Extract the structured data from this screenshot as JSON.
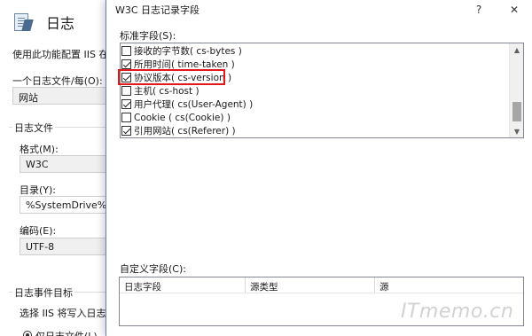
{
  "background_panel": {
    "title": "日志",
    "description": "使用此功能配置 IIS 在 W",
    "one_log_per_label": "一个日志文件/每(O):",
    "one_log_per_value": "网站",
    "log_file_group": "日志文件",
    "format_label": "格式(M):",
    "format_value": "W3C",
    "directory_label": "目录(Y):",
    "directory_value": "%SystemDrive%\\inet",
    "encoding_label": "编码(E):",
    "encoding_value": "UTF-8",
    "event_target_group": "日志事件目标",
    "event_target_desc": "选择 IIS 将写入日志事",
    "radio_label": "仅日志文件(L)"
  },
  "dialog": {
    "title": "W3C 日志记录字段",
    "help_button": "?",
    "close_button": "✕",
    "standard_fields_label": "标准字段(S):",
    "standard_fields": [
      {
        "label": "接收的字节数( cs-bytes )",
        "checked": false
      },
      {
        "label": "所用时间( time-taken )",
        "checked": true
      },
      {
        "label": "协议版本( cs-version )",
        "checked": true
      },
      {
        "label": "主机( cs-host )",
        "checked": false
      },
      {
        "label": "用户代理( cs(User-Agent) )",
        "checked": true
      },
      {
        "label": "Cookie ( cs(Cookie) )",
        "checked": false
      },
      {
        "label": "引用网站( cs(Referer) )",
        "checked": true
      }
    ],
    "custom_fields_label": "自定义字段(C):",
    "custom_columns": [
      "日志字段",
      "源类型",
      "源"
    ]
  },
  "watermark": "ITmemo.cn",
  "colors": {
    "highlight": "#e01a1a",
    "dialog_border": "#5b7fb0",
    "watermark": "#d2d2d2"
  }
}
